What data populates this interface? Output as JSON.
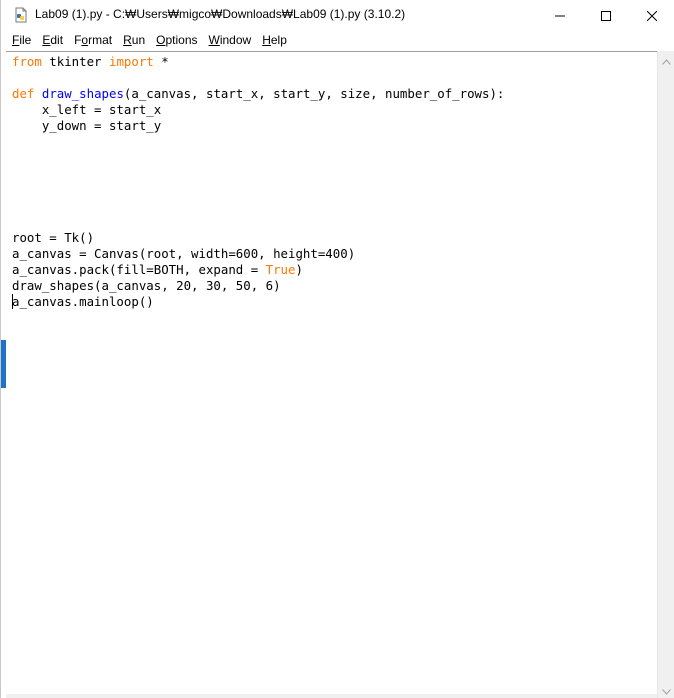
{
  "window": {
    "title": "Lab09 (1).py - C:₩Users₩migco₩Downloads₩Lab09 (1).py (3.10.2)",
    "icon": "python-idle-icon",
    "controls": {
      "minimize_icon": "minimize-icon",
      "maximize_icon": "maximize-icon",
      "close_icon": "close-icon"
    }
  },
  "menu": {
    "items": [
      {
        "mnemonic": "F",
        "rest": "ile"
      },
      {
        "mnemonic": "E",
        "rest": "dit"
      },
      {
        "mnemonic": "",
        "pre": "F",
        "mnemonic2": "o",
        "rest": "rmat"
      },
      {
        "mnemonic": "R",
        "rest": "un"
      },
      {
        "mnemonic": "O",
        "rest": "ptions"
      },
      {
        "mnemonic": "W",
        "rest": "indow"
      },
      {
        "mnemonic": "H",
        "rest": "elp"
      }
    ]
  },
  "editor": {
    "lines": [
      [
        {
          "t": "from",
          "c": "kw"
        },
        {
          "t": " tkinter "
        },
        {
          "t": "import",
          "c": "kw"
        },
        {
          "t": " *"
        }
      ],
      [],
      [
        {
          "t": "def",
          "c": "kw"
        },
        {
          "t": " "
        },
        {
          "t": "draw_shapes",
          "c": "def"
        },
        {
          "t": "(a_canvas, start_x, start_y, size, number_of_rows):"
        }
      ],
      [
        {
          "t": "    x_left = start_x"
        }
      ],
      [
        {
          "t": "    y_down = start_y"
        }
      ],
      [],
      [],
      [],
      [],
      [],
      [],
      [
        {
          "t": "root = Tk()"
        }
      ],
      [
        {
          "t": "a_canvas = Canvas(root, width=600, height=400)"
        }
      ],
      [
        {
          "t": "a_canvas.pack(fill=BOTH, expand = "
        },
        {
          "t": "True",
          "c": "kw"
        },
        {
          "t": ")"
        }
      ],
      [
        {
          "t": "draw_shapes(a_canvas, 20, 30, 50, 6)"
        }
      ],
      [
        {
          "t": "a_canvas.mainloop()"
        }
      ]
    ]
  },
  "scrollbar": {
    "up_icon": "scroll-up-arrow-icon",
    "down_icon": "scroll-down-arrow-icon"
  },
  "colors": {
    "keyword": "#ff7700",
    "definition": "#0000ff",
    "text": "#000000"
  }
}
